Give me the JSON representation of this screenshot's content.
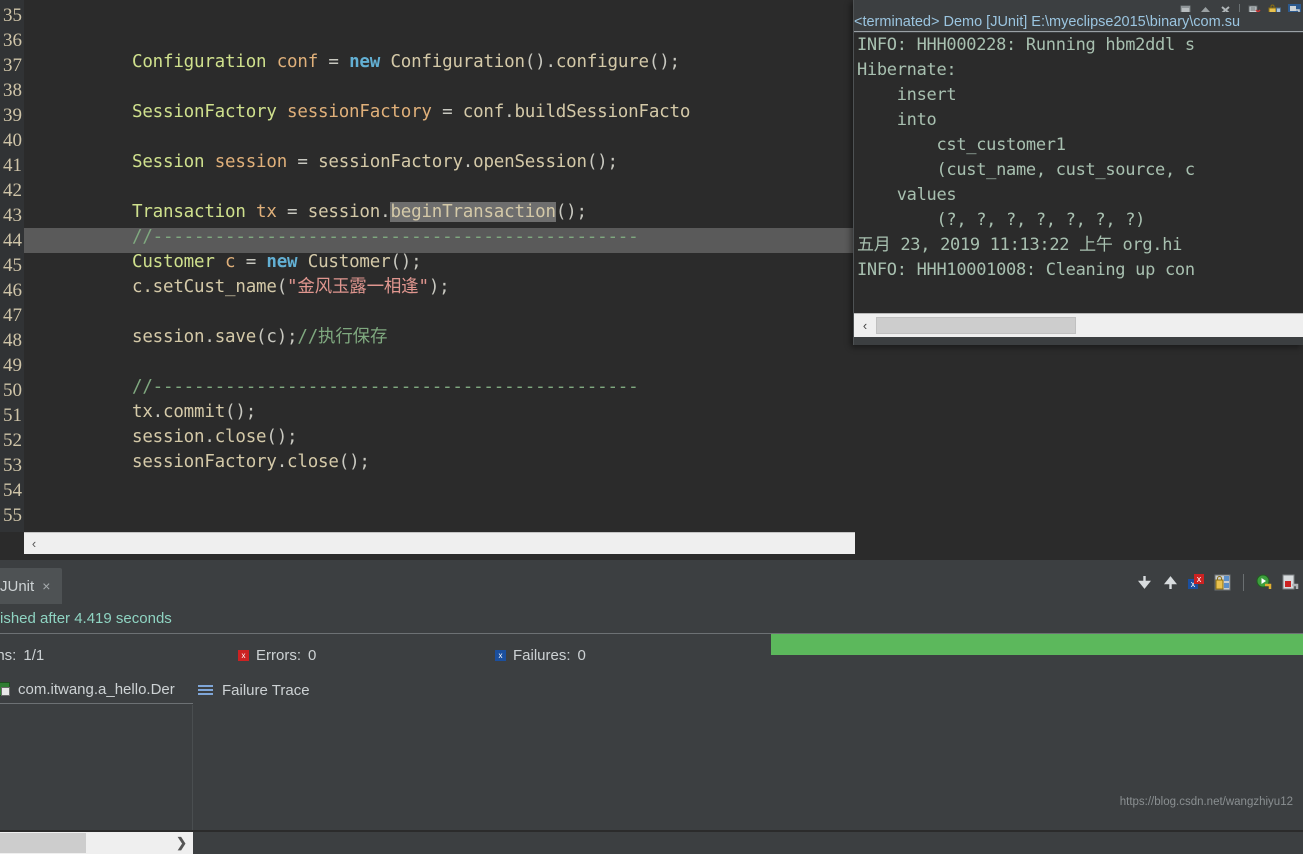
{
  "editor": {
    "line_numbers": [
      "35",
      "36",
      "37",
      "38",
      "39",
      "40",
      "41",
      "42",
      "43",
      "44",
      "45",
      "46",
      "47",
      "48",
      "49",
      "50",
      "51",
      "52",
      "53",
      "54",
      "55"
    ],
    "lines": [
      {
        "n": "37",
        "segments": [
          {
            "t": "Configuration",
            "c": "cls"
          },
          {
            "t": " ",
            "c": "plain"
          },
          {
            "t": "conf",
            "c": "var"
          },
          {
            "t": " = ",
            "c": "plain"
          },
          {
            "t": "new",
            "c": "kw"
          },
          {
            "t": " ",
            "c": "plain"
          },
          {
            "t": "Configuration",
            "c": "fn"
          },
          {
            "t": "().",
            "c": "punc"
          },
          {
            "t": "configure",
            "c": "fn"
          },
          {
            "t": "();",
            "c": "punc"
          }
        ]
      },
      {
        "n": "39",
        "segments": [
          {
            "t": "SessionFactory",
            "c": "cls"
          },
          {
            "t": " ",
            "c": "plain"
          },
          {
            "t": "sessionFactory",
            "c": "var"
          },
          {
            "t": " = ",
            "c": "plain"
          },
          {
            "t": "conf",
            "c": "fn"
          },
          {
            "t": ".",
            "c": "punc"
          },
          {
            "t": "buildSessionFacto",
            "c": "fn"
          }
        ]
      },
      {
        "n": "41",
        "segments": [
          {
            "t": "Session",
            "c": "cls"
          },
          {
            "t": " ",
            "c": "plain"
          },
          {
            "t": "session",
            "c": "var"
          },
          {
            "t": " = ",
            "c": "plain"
          },
          {
            "t": "sessionFactory",
            "c": "fn"
          },
          {
            "t": ".",
            "c": "punc"
          },
          {
            "t": "openSession",
            "c": "fn"
          },
          {
            "t": "();",
            "c": "punc"
          }
        ]
      },
      {
        "n": "43",
        "segments": [
          {
            "t": "Transaction",
            "c": "cls"
          },
          {
            "t": " ",
            "c": "plain"
          },
          {
            "t": "tx",
            "c": "var"
          },
          {
            "t": " = ",
            "c": "plain"
          },
          {
            "t": "session",
            "c": "fn"
          },
          {
            "t": ".",
            "c": "punc"
          },
          {
            "t": "beginTransaction",
            "c": "fn sel-token"
          },
          {
            "t": "();",
            "c": "punc"
          }
        ]
      },
      {
        "n": "44",
        "segments": [
          {
            "t": "//-----------------------------------------------",
            "c": "cmt"
          }
        ]
      },
      {
        "n": "45",
        "segments": [
          {
            "t": "Customer",
            "c": "cls"
          },
          {
            "t": " ",
            "c": "plain"
          },
          {
            "t": "c",
            "c": "var"
          },
          {
            "t": " = ",
            "c": "plain"
          },
          {
            "t": "new",
            "c": "kw"
          },
          {
            "t": " ",
            "c": "plain"
          },
          {
            "t": "Customer",
            "c": "fn"
          },
          {
            "t": "();",
            "c": "punc"
          }
        ]
      },
      {
        "n": "46",
        "segments": [
          {
            "t": "c.setCust_name",
            "c": "fn"
          },
          {
            "t": "(",
            "c": "punc"
          },
          {
            "t": "\"金风玉露一相逢\"",
            "c": "str"
          },
          {
            "t": ");",
            "c": "punc"
          }
        ]
      },
      {
        "n": "48",
        "segments": [
          {
            "t": "session",
            "c": "fn"
          },
          {
            "t": ".",
            "c": "punc"
          },
          {
            "t": "save",
            "c": "fn"
          },
          {
            "t": "(c);",
            "c": "punc"
          },
          {
            "t": "//执行保存",
            "c": "cmt"
          }
        ]
      },
      {
        "n": "50",
        "segments": [
          {
            "t": "//-----------------------------------------------",
            "c": "cmt"
          }
        ]
      },
      {
        "n": "51",
        "segments": [
          {
            "t": "tx",
            "c": "fn"
          },
          {
            "t": ".",
            "c": "punc"
          },
          {
            "t": "commit",
            "c": "fn"
          },
          {
            "t": "();",
            "c": "punc"
          }
        ]
      },
      {
        "n": "52",
        "segments": [
          {
            "t": "session",
            "c": "fn"
          },
          {
            "t": ".",
            "c": "punc"
          },
          {
            "t": "close",
            "c": "fn"
          },
          {
            "t": "();",
            "c": "punc"
          }
        ]
      },
      {
        "n": "53",
        "segments": [
          {
            "t": "sessionFactory",
            "c": "fn"
          },
          {
            "t": ".",
            "c": "punc"
          },
          {
            "t": "close",
            "c": "fn"
          },
          {
            "t": "();",
            "c": "punc"
          }
        ]
      }
    ]
  },
  "console": {
    "title": "<terminated> Demo [JUnit] E:\\myeclipse2015\\binary\\com.su",
    "lines": [
      "INFO: HHH000228: Running hbm2ddl s",
      "Hibernate:",
      "    insert",
      "    into",
      "        cst_customer1",
      "        (cust_name, cust_source, c",
      "    values",
      "        (?, ?, ?, ?, ?, ?, ?)",
      "五月 23, 2019 11:13:22 上午 org.hi",
      "INFO: HHH10001008: Cleaning up con"
    ],
    "toolbar_icons": [
      "minimize-icon",
      "maximize-restore-icon",
      "close-icon",
      "clear-console-icon",
      "lock-scroll-icon",
      "pin-console-icon"
    ],
    "scroll_left_arrow": "‹"
  },
  "junit": {
    "tab_label": "JUnit",
    "tab_close": "×",
    "status_text": "ished after 4.419 seconds",
    "runs_label": "uns:",
    "runs_value": "1/1",
    "errors_label": "Errors:",
    "errors_value": "0",
    "failures_label": "Failures:",
    "failures_value": "0",
    "progress_color": "#5cb85c",
    "progress_percent": 100,
    "test_tree_item": "com.itwang.a_hello.Der",
    "failure_trace_label": "Failure Trace",
    "toolbar_icons": [
      "next-failure-icon",
      "previous-failure-icon",
      "show-failures-only-icon",
      "lock-layout-icon",
      "rerun-test-icon",
      "rerun-failed-icon"
    ],
    "scroll_right_arrow": "❯"
  },
  "watermark": "https://blog.csdn.net/wangzhiyu12"
}
